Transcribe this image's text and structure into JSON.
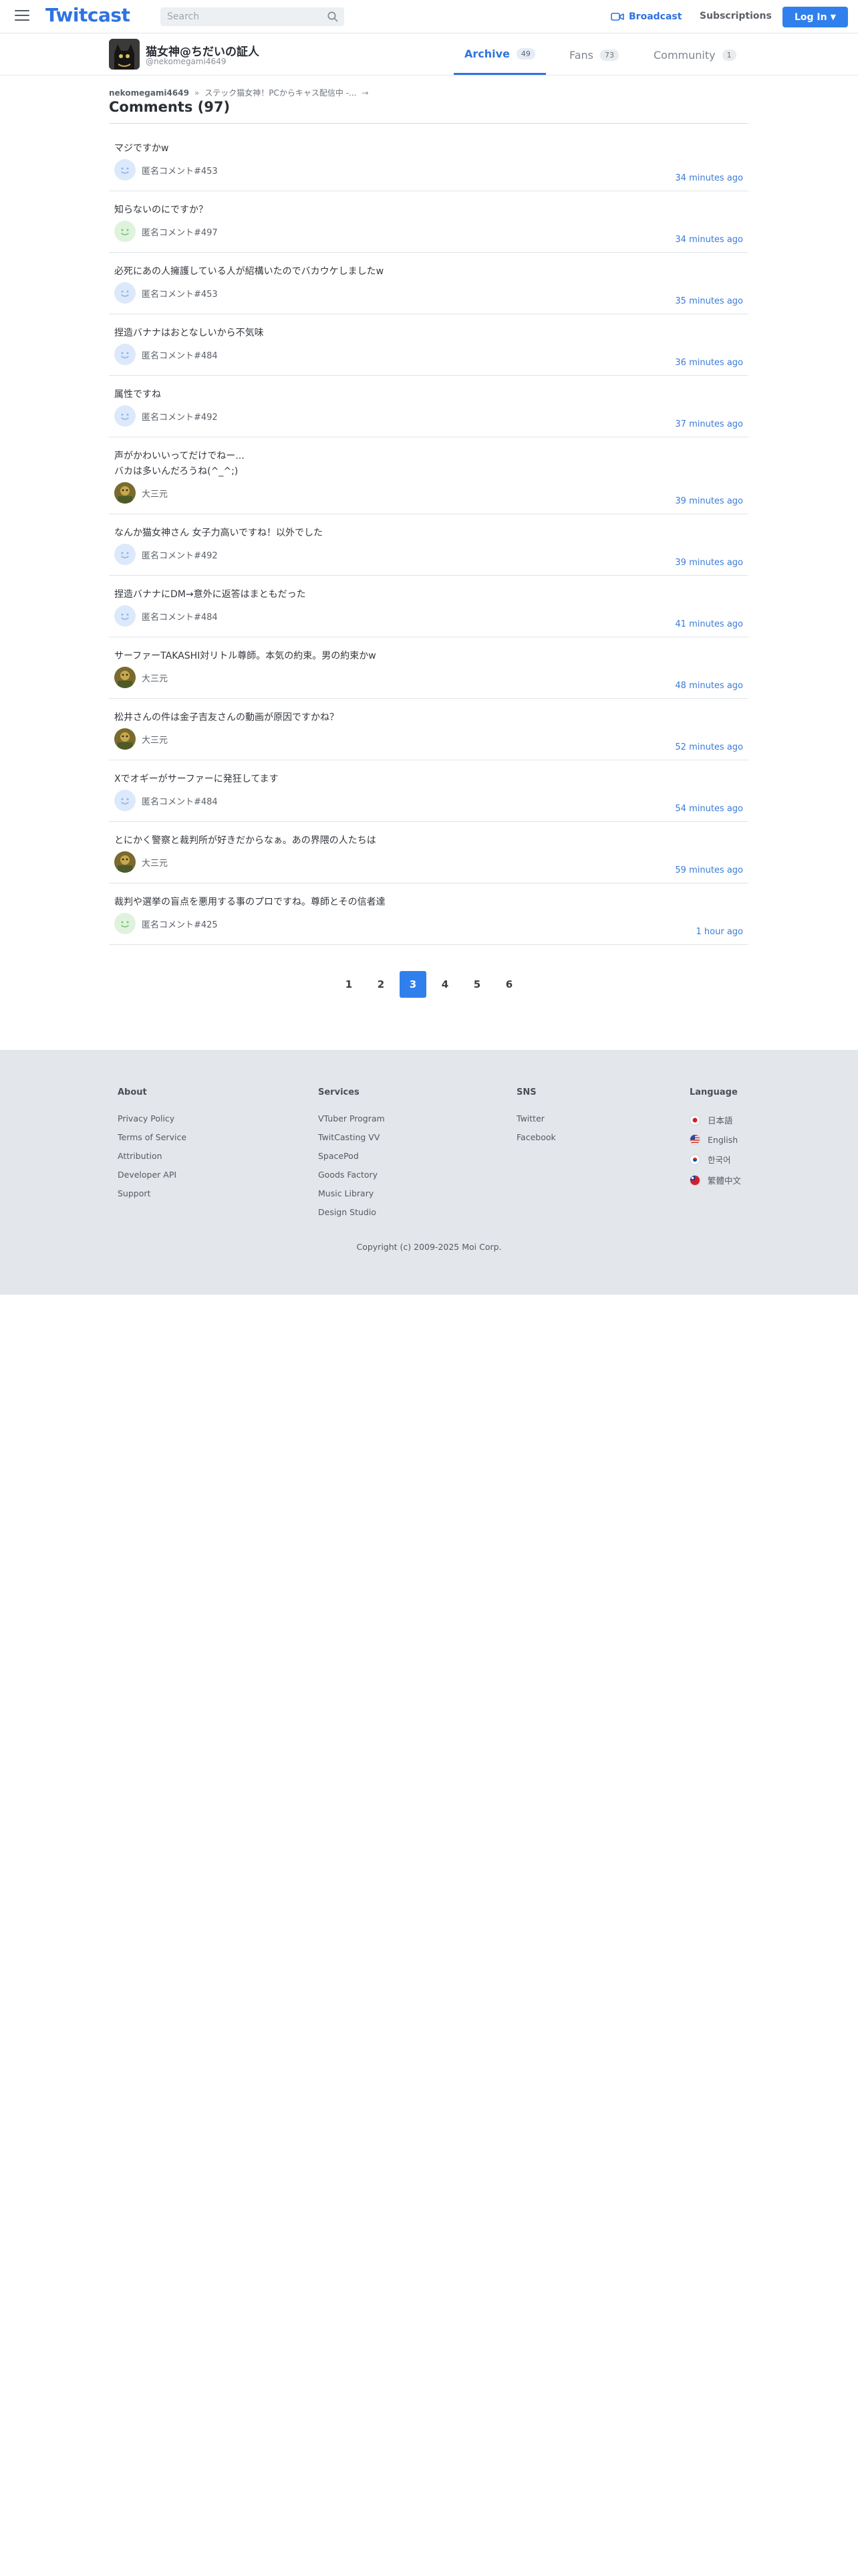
{
  "header": {
    "logo": "Twitcast",
    "search_placeholder": "Search",
    "broadcast_label": "Broadcast",
    "subscriptions_label": "Subscriptions",
    "login_label": "Log In",
    "accent_color": "#2f80ed"
  },
  "user": {
    "display_name": "猫女神@ちだいの証人",
    "handle": "@nekomegami4649",
    "tabs": [
      {
        "label": "Archive",
        "count": "49",
        "active": true
      },
      {
        "label": "Fans",
        "count": "73",
        "active": false
      },
      {
        "label": "Community",
        "count": "1",
        "active": false
      }
    ]
  },
  "breadcrumb": {
    "user": "nekomegami4649",
    "separator": "»",
    "movie": "ステック猫女神！PCからキャス配信中 -...",
    "arrow": "→"
  },
  "page_title": "Comments (97)",
  "comments": [
    {
      "text": "マジですかw",
      "user": "匿名コメント#453",
      "time": "34 minutes ago",
      "avatar": "anon-blue"
    },
    {
      "text": "知らないのにですか？",
      "user": "匿名コメント#497",
      "time": "34 minutes ago",
      "avatar": "anon-green"
    },
    {
      "text": "必死にあの人擁護している人が紹構いたのでバカウケしましたw",
      "user": "匿名コメント#453",
      "time": "35 minutes ago",
      "avatar": "anon-blue"
    },
    {
      "text": "捏造バナナはおとなしいから不気味",
      "user": "匿名コメント#484",
      "time": "36 minutes ago",
      "avatar": "anon-blue"
    },
    {
      "text": "属性ですね",
      "user": "匿名コメント#492",
      "time": "37 minutes ago",
      "avatar": "anon-blue"
    },
    {
      "text": "声がかわいいってだけでねー...\nバカは多いんだろうね(^_^;)",
      "user": "大三元",
      "time": "39 minutes ago",
      "avatar": "photo"
    },
    {
      "text": "なんか猫女神さん 女子力高いですね！以外でした",
      "user": "匿名コメント#492",
      "time": "39 minutes ago",
      "avatar": "anon-blue"
    },
    {
      "text": "捏造バナナにDM→意外に返答はまともだった",
      "user": "匿名コメント#484",
      "time": "41 minutes ago",
      "avatar": "anon-blue"
    },
    {
      "text": "サーファーTAKASHI対リトル尊師。本気の約束。男の約束かw",
      "user": "大三元",
      "time": "48 minutes ago",
      "avatar": "photo"
    },
    {
      "text": "松井さんの件は金子吉友さんの動画が原因ですかね？",
      "user": "大三元",
      "time": "52 minutes ago",
      "avatar": "photo"
    },
    {
      "text": "Xでオギーがサーファーに発狂してます",
      "user": "匿名コメント#484",
      "time": "54 minutes ago",
      "avatar": "anon-blue"
    },
    {
      "text": "とにかく警察と裁判所が好きだからなぁ。あの界隈の人たちは",
      "user": "大三元",
      "time": "59 minutes ago",
      "avatar": "photo"
    },
    {
      "text": "裁判や選挙の盲点を悪用する事のプロですね。尊師とその信者達",
      "user": "匿名コメント#425",
      "time": "1 hour ago",
      "avatar": "anon-green"
    }
  ],
  "pagination": {
    "pages": [
      "1",
      "2",
      "3",
      "4",
      "5",
      "6"
    ],
    "current": "3"
  },
  "footer": {
    "about": {
      "title": "About",
      "links": [
        "Privacy Policy",
        "Terms of Service",
        "Attribution",
        "Developer API",
        "Support"
      ]
    },
    "services": {
      "title": "Services",
      "links": [
        "VTuber Program",
        "TwitCasting VV",
        "SpacePod",
        "Goods Factory",
        "Music Library",
        "Design Studio"
      ]
    },
    "sns": {
      "title": "SNS",
      "links": [
        "Twitter",
        "Facebook"
      ]
    },
    "language": {
      "title": "Language",
      "links": [
        "日本語",
        "English",
        "한국어",
        "繁體中文"
      ]
    },
    "copyright": "Copyright (c) 2009-2025 Moi Corp."
  }
}
